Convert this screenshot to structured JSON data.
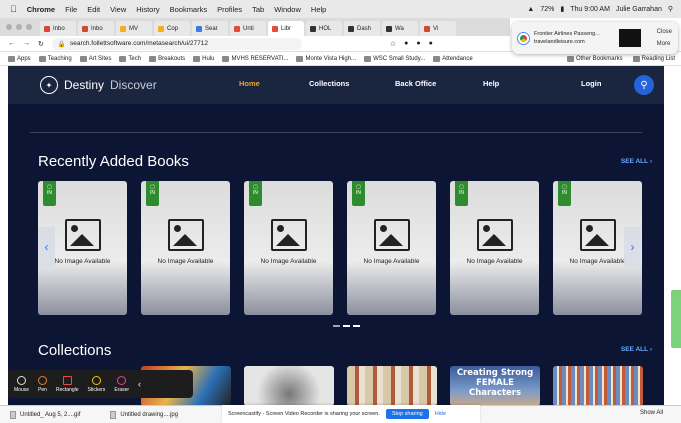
{
  "menubar": {
    "app": "Chrome",
    "items": [
      "File",
      "Edit",
      "View",
      "History",
      "Bookmarks",
      "Profiles",
      "Tab",
      "Window",
      "Help"
    ],
    "battery": "72%",
    "clock": "Thu 9:00 AM",
    "user": "Julie Garrahan"
  },
  "tabs": [
    {
      "label": "Inbo",
      "color": "#d44638"
    },
    {
      "label": "Inbo",
      "color": "#d44638"
    },
    {
      "label": "MV",
      "color": "#f2b01e"
    },
    {
      "label": "Cop",
      "color": "#f2b01e"
    },
    {
      "label": "Sear",
      "color": "#3c7cdb"
    },
    {
      "label": "Unti",
      "color": "#e34d35"
    },
    {
      "label": "Libr",
      "color": "#e34d35"
    },
    {
      "label": "HOL",
      "color": "#333333"
    },
    {
      "label": "Dash",
      "color": "#333333"
    },
    {
      "label": "Wa",
      "color": "#333333"
    },
    {
      "label": "Vi",
      "color": "#d44638"
    }
  ],
  "address": {
    "url": "search.follettsoftware.com/metasearch/ui/27712"
  },
  "bookmarks": {
    "items": [
      "Apps",
      "Teaching",
      "Art Sites",
      "Tech",
      "Breakouts",
      "Hulu",
      "MVHS RESERVATI...",
      "Monte Vista High...",
      "WSC Small Study...",
      "Attendance"
    ],
    "other": "Other Bookmarks",
    "reading": "Reading List"
  },
  "notification": {
    "title": "Frontier Airlines Passeng...",
    "source": "travelandleisure.com",
    "close": "Close",
    "more": "More"
  },
  "site": {
    "brand1": "Destiny",
    "brand2": "Discover",
    "nav": [
      "Home",
      "Collections",
      "Back Office",
      "Help",
      "Login"
    ],
    "recent_title": "Recently Added Books",
    "see_all": "SEE ALL",
    "badge": "IN",
    "no_image": "No Image Available",
    "collections_title": "Collections",
    "collection_text": "Creating Strong FEMALE Characters"
  },
  "toolbar": {
    "tools": [
      "Mouse",
      "Pen",
      "Rectangle",
      "Stickers",
      "Eraser"
    ]
  },
  "downloads": {
    "file1": "Untitled_ Aug 5, 2....gif",
    "file2": "Untitled drawing....jpg",
    "show_all": "Show All"
  },
  "share": {
    "message": "Screencastify - Screen Video Recorder is sharing your screen.",
    "stop": "Stop sharing",
    "hide": "Hide"
  }
}
